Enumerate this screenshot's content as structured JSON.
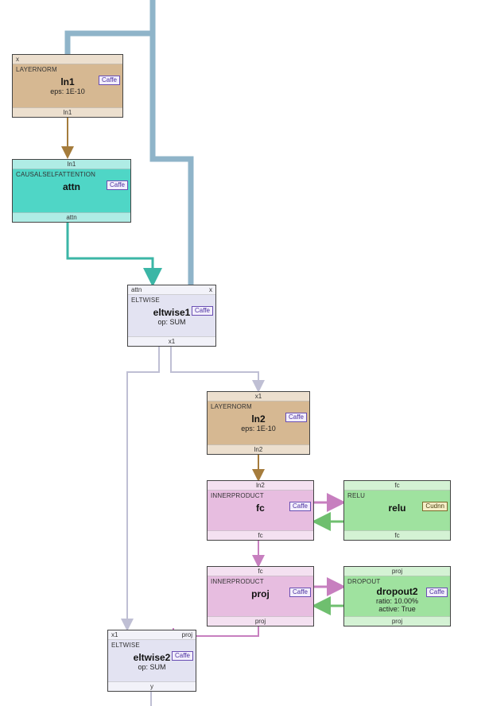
{
  "framework_badge": "Caffe",
  "cudnn_badge": "Cudnn",
  "nodes": {
    "ln1": {
      "type": "LAYERNORM",
      "name": "ln1",
      "params": "eps: 1E-10",
      "port_top_l": "x",
      "port_bot": "ln1"
    },
    "attn": {
      "type": "CAUSALSELFATTENTION",
      "name": "attn",
      "params": "",
      "port_top_c": "ln1",
      "port_bot": "attn"
    },
    "eltwise1": {
      "type": "ELTWISE",
      "name": "eltwise1",
      "params": "op: SUM",
      "port_top_l": "attn",
      "port_top_r": "x",
      "port_bot": "x1"
    },
    "ln2": {
      "type": "LAYERNORM",
      "name": "ln2",
      "params": "eps: 1E-10",
      "port_top_c": "x1",
      "port_bot": "ln2"
    },
    "fc": {
      "type": "INNERPRODUCT",
      "name": "fc",
      "params": "",
      "port_top_c": "ln2",
      "port_bot": "fc"
    },
    "relu": {
      "type": "RELU",
      "name": "relu",
      "params": "",
      "port_top_c": "fc",
      "port_bot": "fc"
    },
    "proj": {
      "type": "INNERPRODUCT",
      "name": "proj",
      "params": "",
      "port_top_c": "fc",
      "port_bot": "proj"
    },
    "dropout2": {
      "type": "DROPOUT",
      "name": "dropout2",
      "params1": "ratio: 10.00%",
      "params2": "active: True",
      "port_top_c": "proj",
      "port_bot": "proj"
    },
    "eltwise2": {
      "type": "ELTWISE",
      "name": "eltwise2",
      "params": "op: SUM",
      "port_top_l": "x1",
      "port_top_r": "proj",
      "port_bot": "y"
    }
  },
  "colors": {
    "layernorm": "#d6b892",
    "attn": "#4fd6c6",
    "eltwise": "#e3e3f2",
    "innerproduct": "#e7bde0",
    "relu": "#9fe29f",
    "dropout": "#9fe29f"
  },
  "chart_data": {
    "type": "diagram",
    "title": "Transformer block (Caffe-style graph)",
    "nodes": [
      {
        "id": "ln1",
        "op": "LAYERNORM",
        "label": "ln1",
        "attrs": {
          "eps": "1E-10"
        },
        "inputs": [
          "x"
        ],
        "outputs": [
          "ln1"
        ],
        "backend": "Caffe"
      },
      {
        "id": "attn",
        "op": "CAUSALSELFATTENTION",
        "label": "attn",
        "inputs": [
          "ln1"
        ],
        "outputs": [
          "attn"
        ],
        "backend": "Caffe"
      },
      {
        "id": "eltwise1",
        "op": "ELTWISE",
        "label": "eltwise1",
        "attrs": {
          "op": "SUM"
        },
        "inputs": [
          "attn",
          "x"
        ],
        "outputs": [
          "x1"
        ],
        "backend": "Caffe"
      },
      {
        "id": "ln2",
        "op": "LAYERNORM",
        "label": "ln2",
        "attrs": {
          "eps": "1E-10"
        },
        "inputs": [
          "x1"
        ],
        "outputs": [
          "ln2"
        ],
        "backend": "Caffe"
      },
      {
        "id": "fc",
        "op": "INNERPRODUCT",
        "label": "fc",
        "inputs": [
          "ln2"
        ],
        "outputs": [
          "fc"
        ],
        "backend": "Caffe"
      },
      {
        "id": "relu",
        "op": "RELU",
        "label": "relu",
        "inputs": [
          "fc"
        ],
        "outputs": [
          "fc"
        ],
        "backend": "Cudnn"
      },
      {
        "id": "proj",
        "op": "INNERPRODUCT",
        "label": "proj",
        "inputs": [
          "fc"
        ],
        "outputs": [
          "proj"
        ],
        "backend": "Caffe"
      },
      {
        "id": "dropout2",
        "op": "DROPOUT",
        "label": "dropout2",
        "attrs": {
          "ratio": "10.00%",
          "active": "True"
        },
        "inputs": [
          "proj"
        ],
        "outputs": [
          "proj"
        ],
        "backend": "Caffe"
      },
      {
        "id": "eltwise2",
        "op": "ELTWISE",
        "label": "eltwise2",
        "attrs": {
          "op": "SUM"
        },
        "inputs": [
          "x1",
          "proj"
        ],
        "outputs": [
          "y"
        ],
        "backend": "Caffe"
      }
    ],
    "edges": [
      {
        "from": "external:x_in",
        "to": "ln1",
        "tensor": "x"
      },
      {
        "from": "external:x_in",
        "to": "eltwise1",
        "tensor": "x"
      },
      {
        "from": "ln1",
        "to": "attn",
        "tensor": "ln1"
      },
      {
        "from": "attn",
        "to": "eltwise1",
        "tensor": "attn"
      },
      {
        "from": "eltwise1",
        "to": "ln2",
        "tensor": "x1"
      },
      {
        "from": "eltwise1",
        "to": "eltwise2",
        "tensor": "x1"
      },
      {
        "from": "ln2",
        "to": "fc",
        "tensor": "ln2"
      },
      {
        "from": "fc",
        "to": "relu",
        "tensor": "fc"
      },
      {
        "from": "relu",
        "to": "fc",
        "tensor": "fc"
      },
      {
        "from": "fc",
        "to": "proj",
        "tensor": "fc"
      },
      {
        "from": "proj",
        "to": "dropout2",
        "tensor": "proj"
      },
      {
        "from": "dropout2",
        "to": "proj",
        "tensor": "proj"
      },
      {
        "from": "proj",
        "to": "eltwise2",
        "tensor": "proj"
      },
      {
        "from": "eltwise2",
        "to": "external:y_out",
        "tensor": "y"
      }
    ]
  }
}
